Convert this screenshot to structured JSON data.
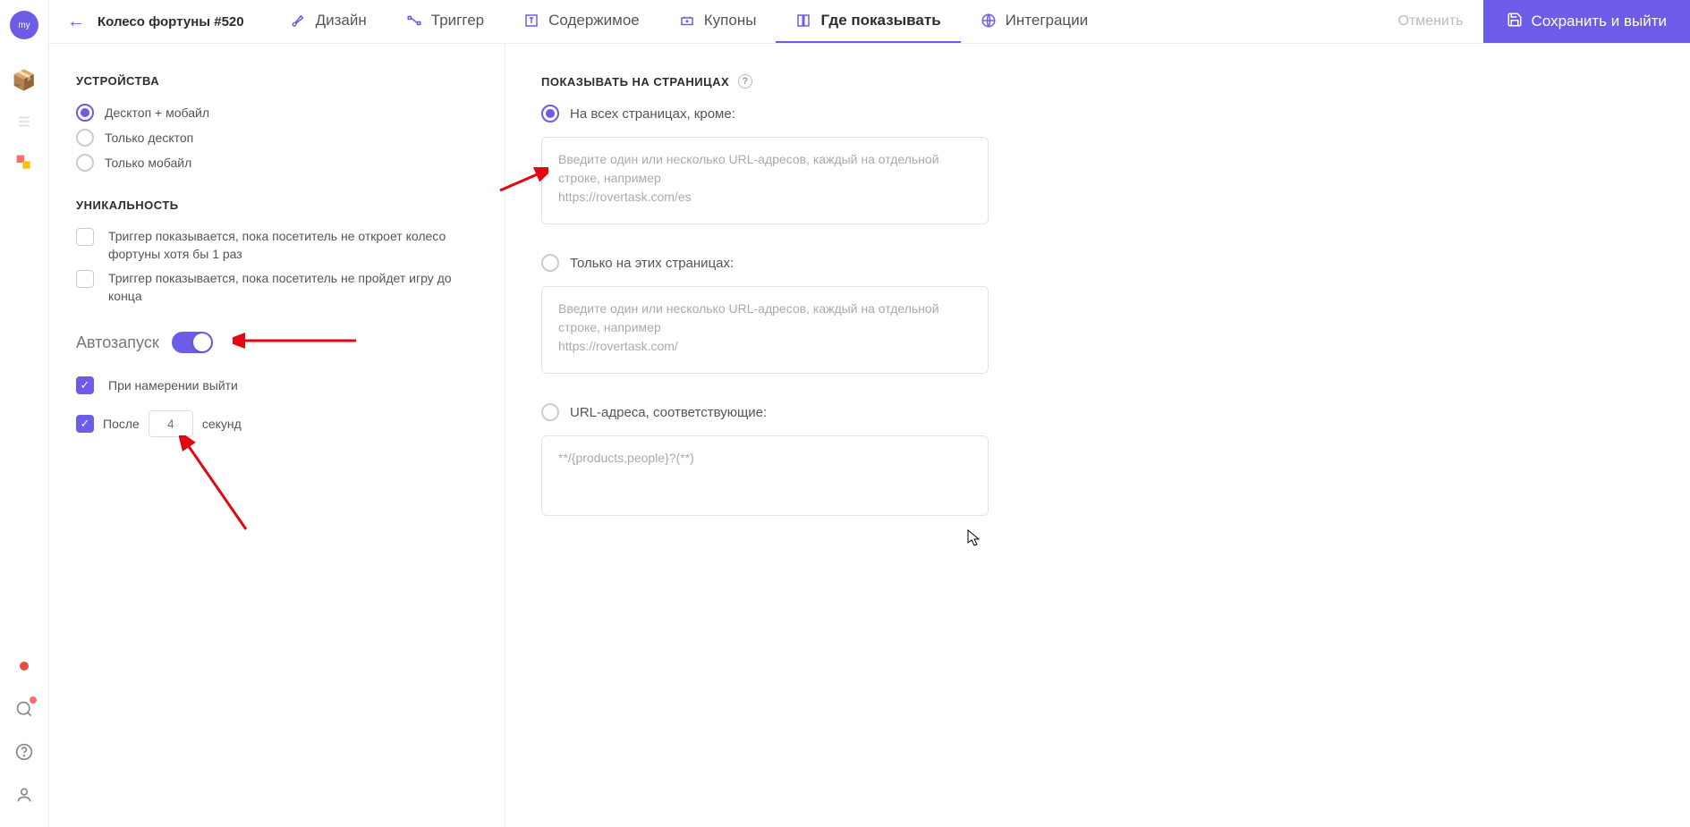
{
  "rail": {
    "avatar": "my"
  },
  "header": {
    "title": "Колесо фортуны #520",
    "tabs": {
      "design": "Дизайн",
      "trigger": "Триггер",
      "content": "Содержимое",
      "coupons": "Купоны",
      "where": "Где показывать",
      "integrations": "Интеграции"
    },
    "actions": {
      "cancel": "Отменить",
      "save": "Сохранить и выйти"
    }
  },
  "left": {
    "devices": {
      "title": "УСТРОЙСТВА",
      "opts": {
        "both": "Десктоп + мобайл",
        "desktop": "Только десктоп",
        "mobile": "Только мобайл"
      }
    },
    "uniqueness": {
      "title": "УНИКАЛЬНОСТЬ",
      "opt1": "Триггер показывается, пока посетитель не откроет колесо фортуны хотя бы 1 раз",
      "opt2": "Триггер показывается, пока посетитель не пройдет игру до конца"
    },
    "autostart": {
      "label": "Автозапуск",
      "exit_intent": "При намерении выйти",
      "after_prefix": "После",
      "seconds_value": "4",
      "after_suffix": "секунд"
    }
  },
  "right": {
    "title": "ПОКАЗЫВАТЬ НА СТРАНИЦАХ",
    "all_except": {
      "label": "На всех страницах, кроме:",
      "placeholder": "Введите один или несколько URL-адресов, каждый на отдельной строке, например\nhttps://rovertask.com/es"
    },
    "only_these": {
      "label": "Только на этих страницах:",
      "placeholder": "Введите один или несколько URL-адресов, каждый на отдельной строке, например\nhttps://rovertask.com/"
    },
    "matching": {
      "label": "URL-адреса, соответствующие:",
      "placeholder": "**/{products,people}?(**)"
    }
  }
}
